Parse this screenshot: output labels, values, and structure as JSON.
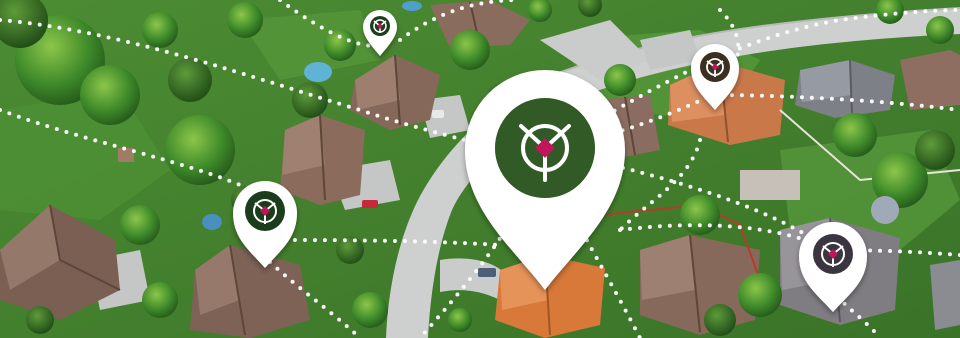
{
  "scene": {
    "description_colors": {
      "lawn": "#4f8f35",
      "lawn_dark": "#2f6a22",
      "tree": "#3c8a2a",
      "tree_light": "#7fbf3f",
      "road": "#cfd2d0",
      "roof_brown": "#8a6a58",
      "roof_orange": "#d9792f",
      "roof_gray": "#7c7f86",
      "pin": "#ffffff",
      "pin_accent": "#c2185b",
      "pin_icon_bg": "#1f3d1a",
      "dots": "#ffffff"
    },
    "pins": [
      {
        "name": "location-pin-small-top-left",
        "icon": "drone-hub-icon"
      },
      {
        "name": "location-pin-small-left",
        "icon": "drone-hub-icon"
      },
      {
        "name": "location-pin-large-center",
        "icon": "drone-hub-icon"
      },
      {
        "name": "location-pin-small-right",
        "icon": "drone-hub-icon"
      },
      {
        "name": "location-pin-medium-bottom-right",
        "icon": "drone-hub-icon"
      }
    ]
  }
}
